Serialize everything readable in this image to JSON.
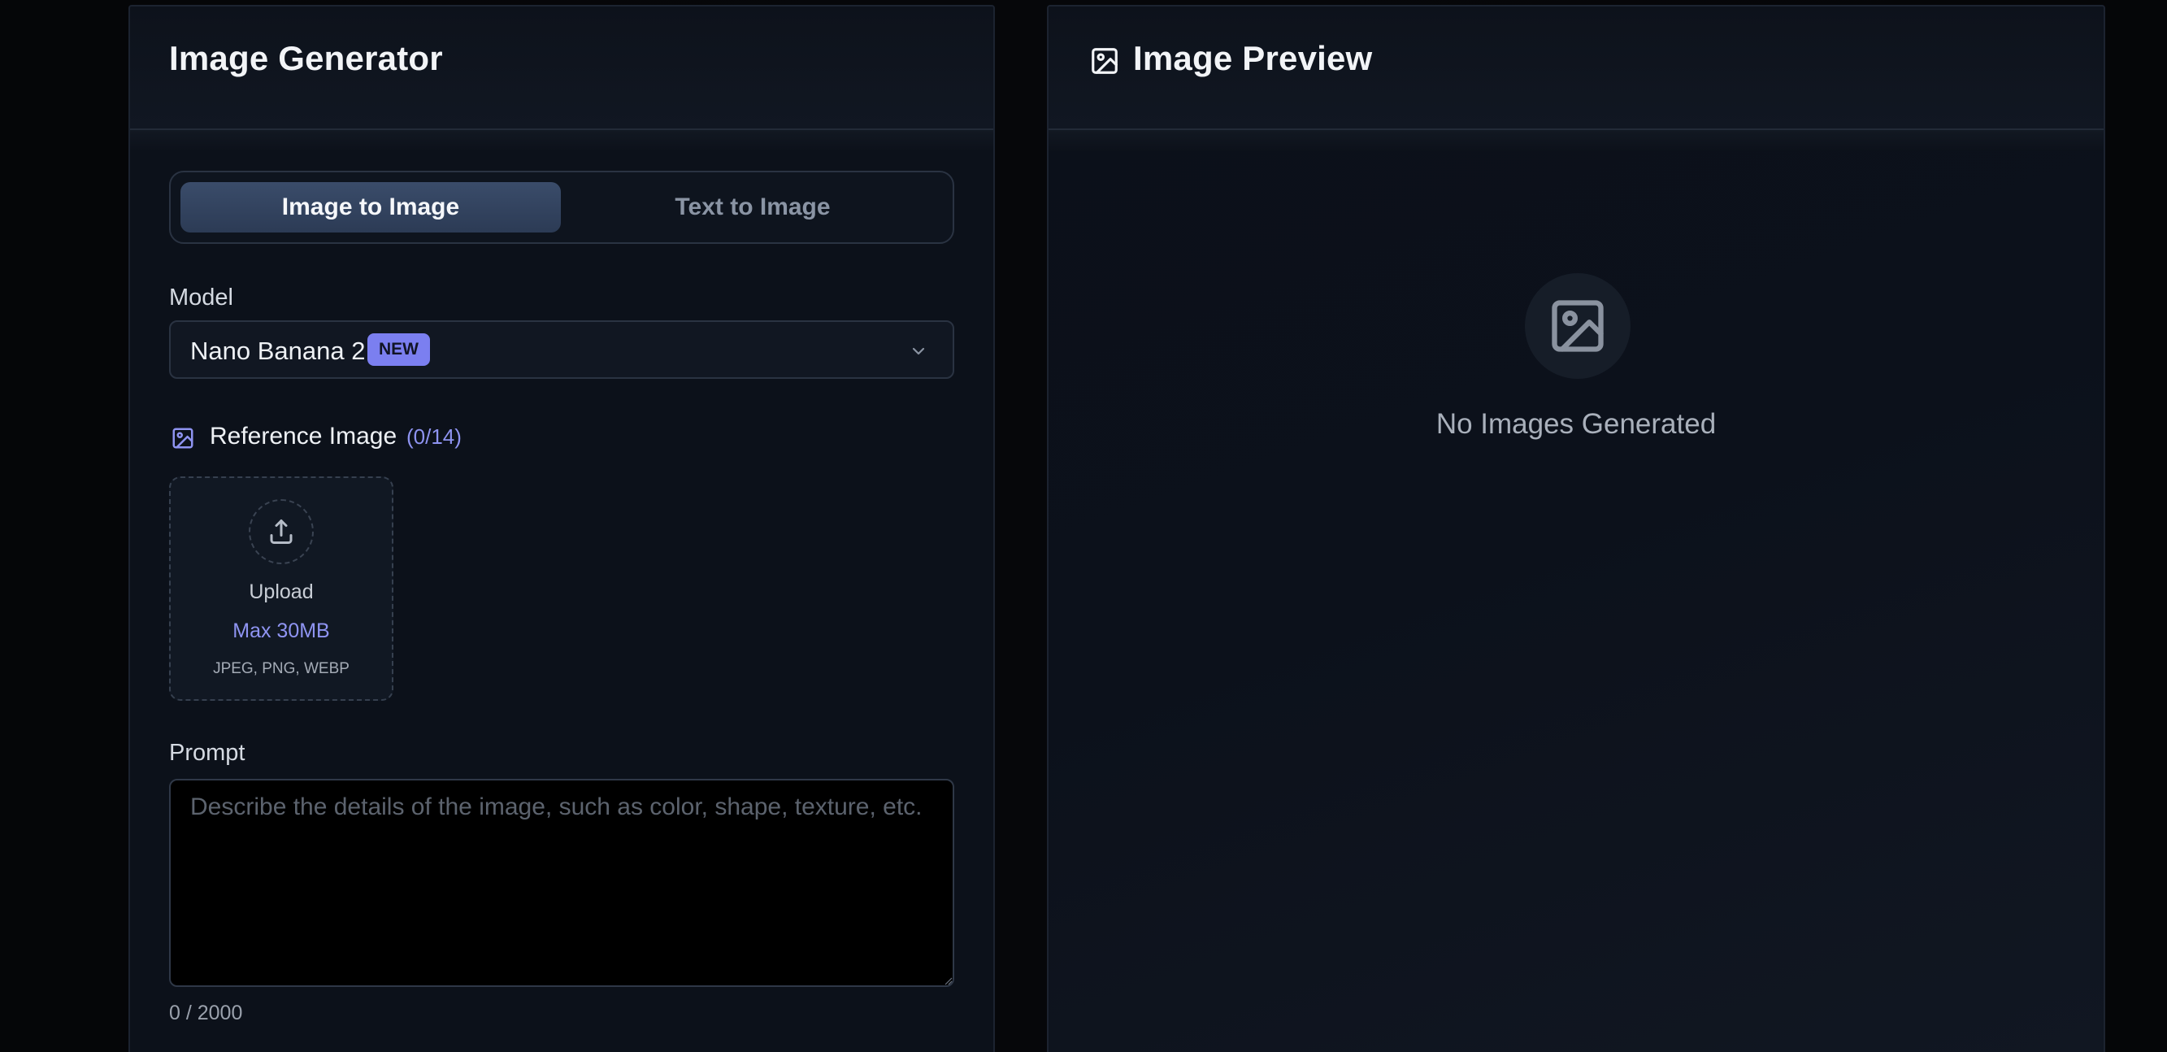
{
  "generator": {
    "title": "Image Generator",
    "modes": {
      "active_label": "Image to Image",
      "inactive_label": "Text to Image"
    },
    "model": {
      "label": "Model",
      "selected": "Nano Banana 2",
      "badge": "NEW"
    },
    "reference": {
      "label": "Reference Image",
      "count": "(0/14)",
      "upload_label": "Upload",
      "max_size": "Max 30MB",
      "formats": "JPEG, PNG, WEBP"
    },
    "prompt": {
      "label": "Prompt",
      "placeholder": "Describe the details of the image, such as color, shape, texture, etc.",
      "value": "",
      "counter": "0 / 2000"
    }
  },
  "preview": {
    "title": "Image Preview",
    "empty_message": "No Images Generated"
  },
  "colors": {
    "accent": "#7b7ff0",
    "active_toggle": "#34445f",
    "panel_bg": "#0c111a"
  },
  "icons": {
    "preview_title": "image-icon",
    "reference": "image-icon",
    "upload": "upload-icon",
    "select": "chevron-down-icon",
    "empty_state": "image-icon"
  }
}
